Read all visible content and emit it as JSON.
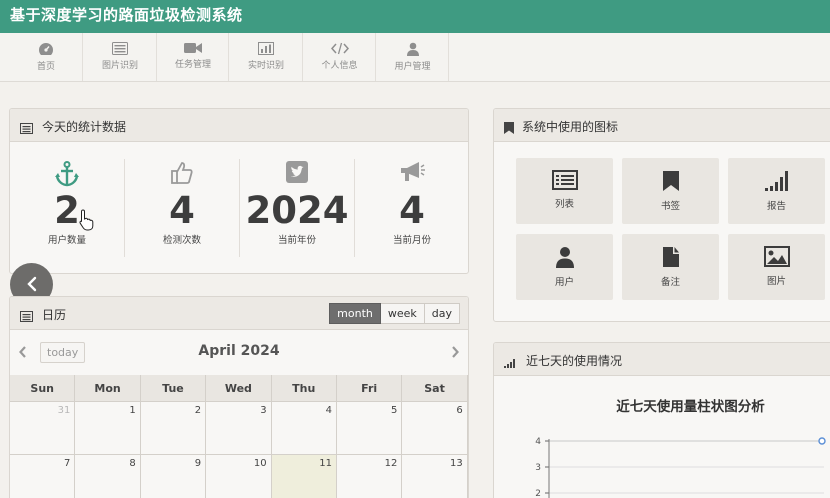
{
  "app": {
    "title": "基于深度学习的路面垃圾检测系统"
  },
  "nav": {
    "items": [
      {
        "label": "首页",
        "icon": "dashboard-icon"
      },
      {
        "label": "图片识别",
        "icon": "list-icon"
      },
      {
        "label": "任务管理",
        "icon": "video-camera-icon"
      },
      {
        "label": "实时识别",
        "icon": "bar-chart-icon"
      },
      {
        "label": "个人信息",
        "icon": "code-icon"
      },
      {
        "label": "用户管理",
        "icon": "user-icon"
      }
    ]
  },
  "stats_panel": {
    "title": "今天的统计数据",
    "stats": [
      {
        "value": "2",
        "label": "用户数量",
        "icon": "anchor-icon",
        "color": "#3f9b82"
      },
      {
        "value": "4",
        "label": "检测次数",
        "icon": "thumbs-up-icon",
        "color": "#9a9a9a"
      },
      {
        "value": "2024",
        "label": "当前年份",
        "icon": "twitter-icon",
        "color": "#9a9a9a"
      },
      {
        "value": "4",
        "label": "当前月份",
        "icon": "bullhorn-icon",
        "color": "#9a9a9a"
      }
    ]
  },
  "icons_panel": {
    "title": "系统中使用的图标",
    "tiles": [
      {
        "label": "列表",
        "icon": "list-icon"
      },
      {
        "label": "书签",
        "icon": "bookmark-icon"
      },
      {
        "label": "报告",
        "icon": "signal-icon"
      },
      {
        "label": "用户",
        "icon": "user-icon"
      },
      {
        "label": "备注",
        "icon": "file-icon"
      },
      {
        "label": "图片",
        "icon": "picture-icon"
      }
    ]
  },
  "calendar": {
    "title": "日历",
    "views": [
      "month",
      "week",
      "day"
    ],
    "active_view": "month",
    "today_label": "today",
    "month_title": "April 2024",
    "weekdays": [
      "Sun",
      "Mon",
      "Tue",
      "Wed",
      "Thu",
      "Fri",
      "Sat"
    ],
    "weeks": [
      [
        "31",
        "1",
        "2",
        "3",
        "4",
        "5",
        "6"
      ],
      [
        "7",
        "8",
        "9",
        "10",
        "11",
        "12",
        "13"
      ]
    ],
    "today": "11"
  },
  "usage_panel": {
    "title": "近七天的使用情况",
    "chart_title": "近七天使用量柱状图分析"
  },
  "chart_data": {
    "type": "line",
    "title": "近七天使用量柱状图分析",
    "y_ticks": [
      "2",
      "3",
      "4"
    ],
    "ylim": [
      2,
      4
    ],
    "grid": true,
    "series_color": "#5b8fd6"
  },
  "colors": {
    "brand": "#3f9b82",
    "nav_bg": "#f4f3f0",
    "today_bg": "#efeedc",
    "active_view": "#6e6e6e"
  }
}
